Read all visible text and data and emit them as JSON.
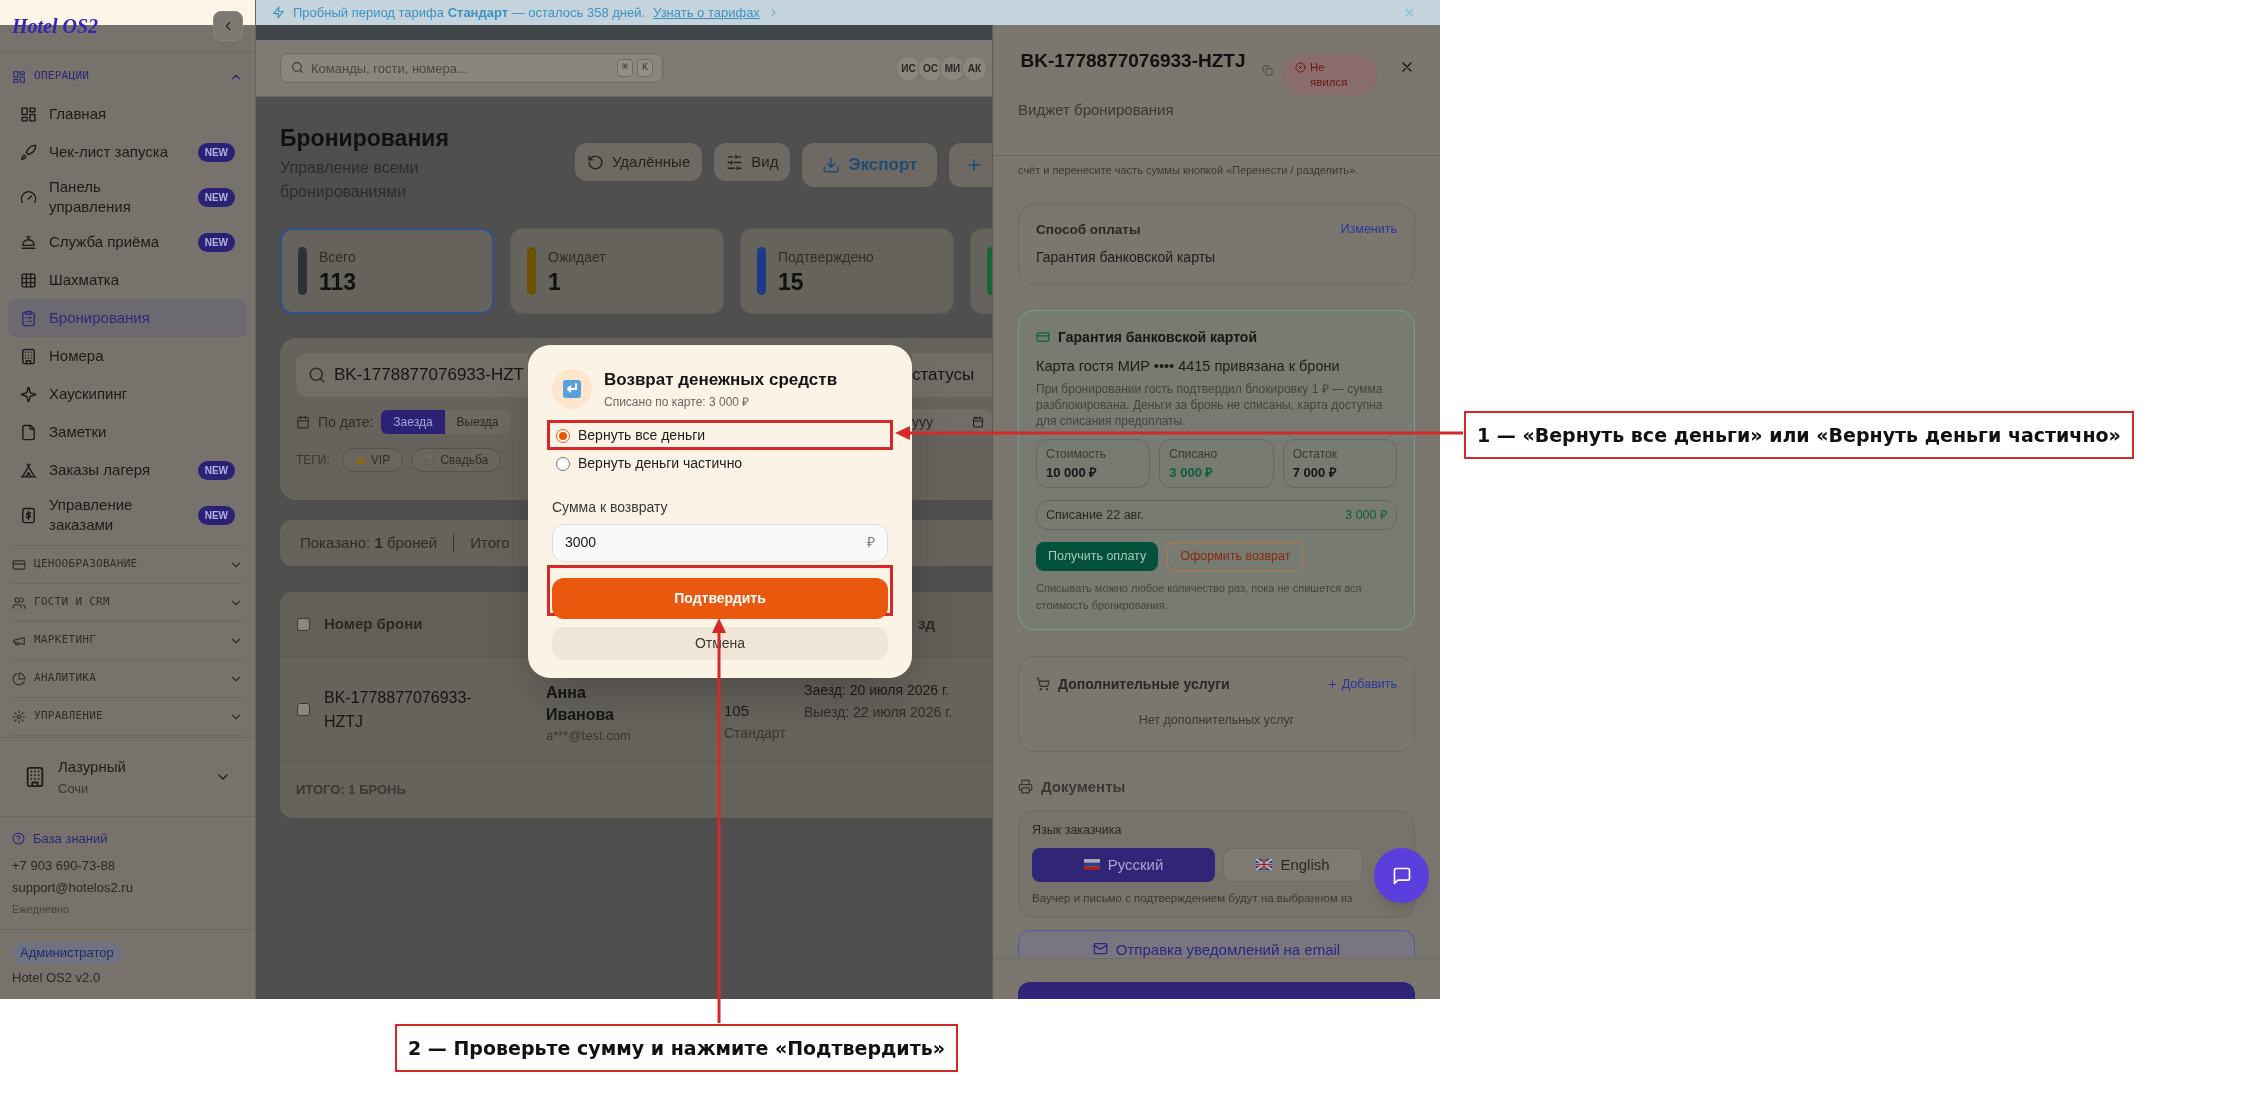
{
  "banner": {
    "text": "Пробный период тарифа **Стандарт** — осталось 358 дней.",
    "link": "Узнать о тарифах"
  },
  "sidebar": {
    "logo": "Hotel OS2",
    "sections": [
      {
        "title": "ОПЕРАЦИИ",
        "expanded": true,
        "items": [
          {
            "label": "Главная",
            "selected": false
          },
          {
            "label": "Чек-лист запуска",
            "badge": "NEW",
            "selected": false
          },
          {
            "label": "Панель управления",
            "badge": "NEW",
            "selected": false
          },
          {
            "label": "Служба приёма",
            "badge": "NEW",
            "selected": false
          },
          {
            "label": "Шахматка",
            "selected": false
          },
          {
            "label": "Бронирования",
            "selected": true
          },
          {
            "label": "Номера",
            "selected": false
          },
          {
            "label": "Хаускипинг",
            "selected": false
          },
          {
            "label": "Заметки",
            "selected": false
          },
          {
            "label": "Заказы лагеря",
            "badge": "NEW",
            "selected": false
          },
          {
            "label": "Управление заказами",
            "badge": "NEW",
            "selected": false
          }
        ]
      },
      {
        "title": "ЦЕНООБРАЗОВАНИЕ",
        "expanded": false
      },
      {
        "title": "ГОСТИ И CRM",
        "expanded": false
      },
      {
        "title": "МАРКЕТИНГ",
        "expanded": false
      },
      {
        "title": "АНАЛИТИКА",
        "expanded": false
      },
      {
        "title": "УПРАВЛЕНИЕ",
        "expanded": false
      }
    ],
    "property": {
      "name": "Лазурный",
      "city": "Сочи"
    },
    "help": {
      "link": "База знаний",
      "phone": "+7 903 690-73-88",
      "email": "support@hotelos2.ru",
      "hours": "Ежедневно"
    },
    "role": "Администратор",
    "version": "Hotel OS2 v2.0"
  },
  "header": {
    "search_placeholder": "Команды, гости, номера...",
    "keys": [
      "⌘",
      "K"
    ],
    "avatars": [
      "ИС",
      "ОС",
      "МИ",
      "АК"
    ]
  },
  "page": {
    "title": "Бронирования",
    "subtitle": "Управление всеми бронированиями",
    "actions": [
      {
        "label": "Удалённые",
        "kind": "history"
      },
      {
        "label": "Вид",
        "kind": "view"
      },
      {
        "label": "Экспорт",
        "kind": "export"
      },
      {
        "kind": "add"
      }
    ],
    "stats": [
      {
        "label": "Всего",
        "value": "113",
        "color": "#2d3238",
        "selected": true
      },
      {
        "label": "Ожидает",
        "value": "1",
        "color": "#6b5200",
        "selected": false
      },
      {
        "label": "Подтверждено",
        "value": "15",
        "color": "#1e3a8a",
        "selected": false
      },
      {
        "color": "#166534",
        "selected": false
      }
    ]
  },
  "filters": {
    "search_value": "BK-1778877076933-HZT",
    "status_select": "статусы",
    "date_label": "По дате:",
    "date_modes": [
      {
        "label": "Заезда",
        "selected": true
      },
      {
        "label": "Выезда",
        "selected": false
      }
    ],
    "date_value": "yyy",
    "tags_label": "ТЕГИ:",
    "tags": [
      "VIP",
      "Свадьба"
    ]
  },
  "summary": {
    "shown": "Показано: **1** броней",
    "total": "Итого"
  },
  "table": {
    "all_selected": false,
    "columns": [
      "Номер брони",
      "зд"
    ],
    "rows": [
      {
        "booking": "BK-1778877076933-HZTJ",
        "guest": "Анна Иванова",
        "email": "a***@test.com",
        "room": "105",
        "room_type": "Стандарт",
        "checkin": "Заезд: 20 июля 2026 г.",
        "checkout": "Выезд: 22 июля 2026 г.",
        "selected": false
      }
    ],
    "footer": "ИТОГО: 1 БРОНЬ"
  },
  "panel": {
    "title": "BK-1778877076933-HZTJ",
    "status": "Не явился",
    "source": "Виджет бронирования",
    "note_fragment": "счёт и перенесите часть суммы кнопкой «Перенести / разделить».",
    "payment_method": {
      "title": "Способ оплаты",
      "action": "Изменить",
      "value": "Гарантия банковской карты"
    },
    "guarantee": {
      "title": "Гарантия банковской картой",
      "card": "Карта гостя МИР •••• 4415 привязана к брони",
      "description": "При бронировании гость подтвердил блокировку 1 ₽ — сумма разблокирована. Деньги за бронь не списаны, карта доступна для списания предоплаты.",
      "figures": [
        {
          "label": "Стоимость",
          "value": "10 000 ₽",
          "kind": "plain"
        },
        {
          "label": "Списано",
          "value": "3 000 ₽",
          "kind": "paid"
        },
        {
          "label": "Остаток",
          "value": "7 000 ₽",
          "kind": "plain"
        }
      ],
      "charges": [
        {
          "label": "Списание 22 авг.",
          "amount": "3 000 ₽"
        }
      ],
      "buttons": [
        {
          "label": "Получить оплату",
          "kind": "primary"
        },
        {
          "label": "Оформить возврат",
          "kind": "refund"
        }
      ],
      "hint": "Списывать можно любое количество раз, пока не спишется вся стоимость бронирования."
    },
    "extras": {
      "title": "Дополнительные услуги",
      "action": "Добавить",
      "empty": "Нет дополнительных услуг"
    },
    "documents": {
      "title": "Документы",
      "language_label": "Язык заказчика",
      "languages": [
        {
          "label": "Русский",
          "selected": true
        },
        {
          "label": "English",
          "selected": false
        }
      ],
      "note": "Ваучер и письмо с подтверждением будут на выбранном яз"
    },
    "email_button": "Отправка уведомлений на email"
  },
  "modal": {
    "title": "Возврат денежных средств",
    "subtitle": "Списано по карте: 3 000 ₽",
    "options": [
      {
        "label": "Вернуть все деньги",
        "selected": true
      },
      {
        "label": "Вернуть деньги частично",
        "selected": false
      }
    ],
    "amount_label": "Сумма к возврату",
    "amount_value": "3000",
    "currency": "₽",
    "confirm": "Подтвердить",
    "cancel": "Отмена"
  },
  "annotations": [
    "1 — «Вернуть все деньги» или «Вернуть деньги частично»",
    "2 — Проверьте сумму и нажмите «Подтвердить»"
  ]
}
